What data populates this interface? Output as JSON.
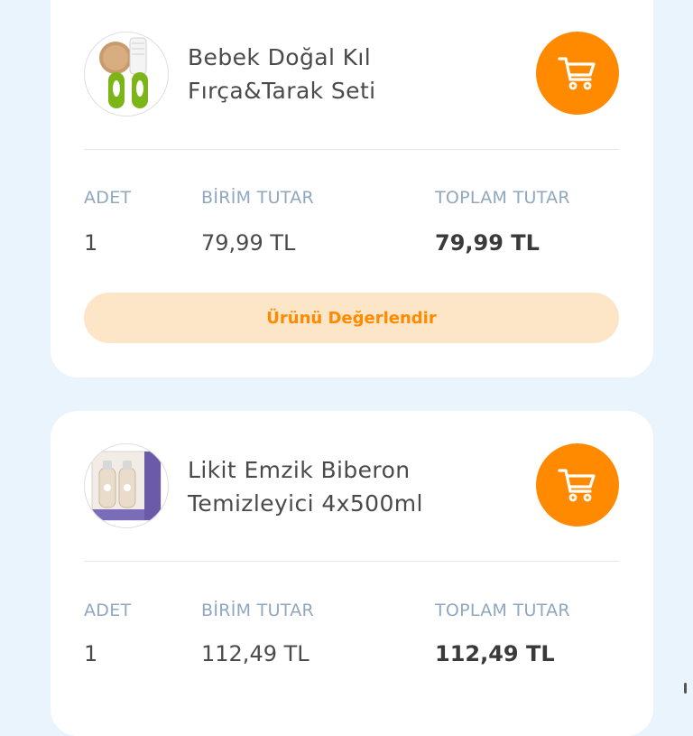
{
  "colors": {
    "accent": "#ff8a00",
    "accent_soft": "#fde6c8",
    "background": "#eaf4fc",
    "label": "#8fa7bf"
  },
  "labels": {
    "qty": "ADET",
    "unit_price": "BİRİM TUTAR",
    "total_price": "TOPLAM TUTAR"
  },
  "items": [
    {
      "name": "Bebek Doğal Kıl Fırça&Tarak Seti",
      "qty": "1",
      "unit_price": "79,99 TL",
      "total_price": "79,99 TL",
      "rate_label": "Ürünü Değerlendir",
      "icon": "cart-icon"
    },
    {
      "name": "Likit Emzik Biberon Temizleyici 4x500ml",
      "qty": "1",
      "unit_price": "112,49 TL",
      "total_price": "112,49 TL",
      "icon": "cart-icon"
    }
  ]
}
